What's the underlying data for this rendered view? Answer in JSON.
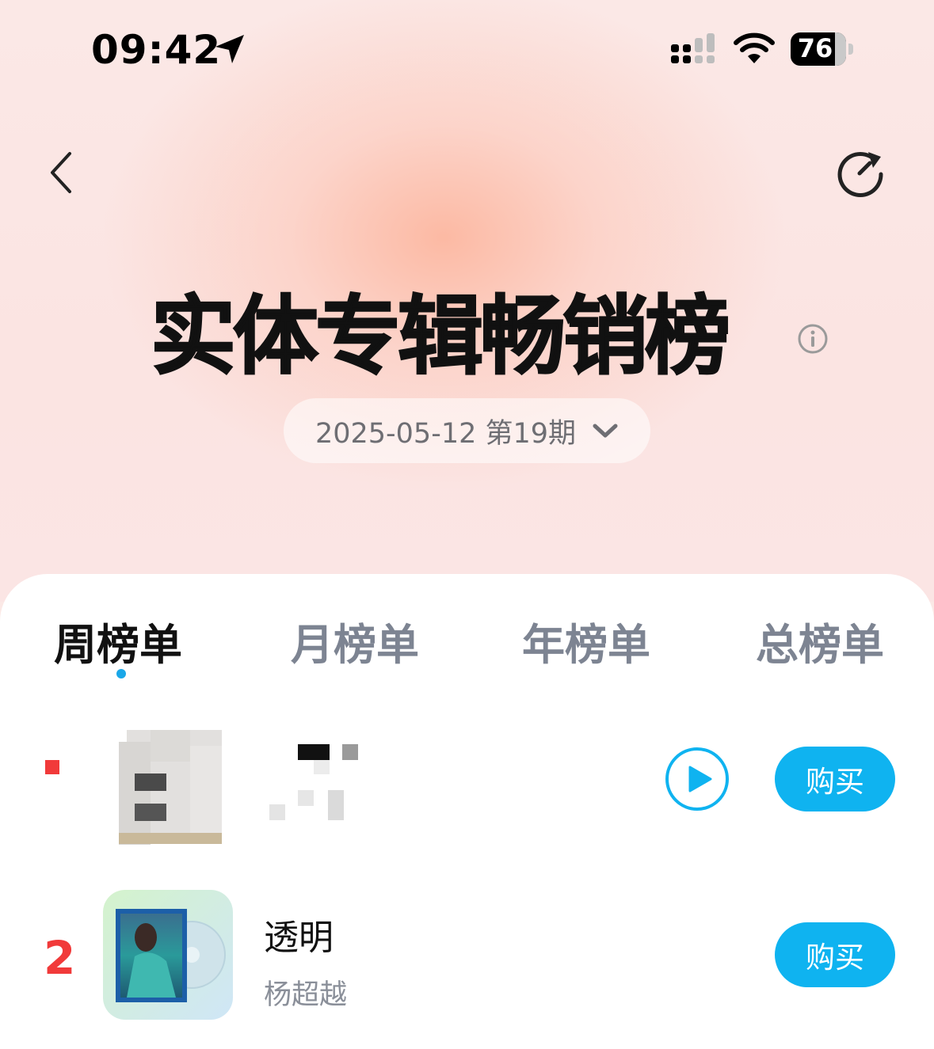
{
  "status_bar": {
    "time": "09:42",
    "battery": "76"
  },
  "header": {
    "title": "实体专辑畅销榜",
    "period_label": "2025-05-12 第19期"
  },
  "tabs": [
    "周榜单",
    "月榜单",
    "年榜单",
    "总榜单"
  ],
  "active_tab": "周榜单",
  "albums": [
    {
      "rank": "",
      "title": "",
      "artist": "",
      "buy_label": "购买"
    },
    {
      "rank": "2",
      "title": "透明",
      "artist": "杨超越",
      "buy_label": "购买"
    }
  ],
  "colors": {
    "accent": "#0fb3f0",
    "rank_red": "#f13a3a",
    "title_text": "#111111",
    "muted": "#7d8492"
  },
  "icons": [
    "location-arrow-icon",
    "cellular-signal-icon",
    "wifi-icon",
    "battery-icon",
    "back-chevron-icon",
    "refresh-icon",
    "info-icon",
    "chevron-down-icon",
    "play-icon"
  ]
}
